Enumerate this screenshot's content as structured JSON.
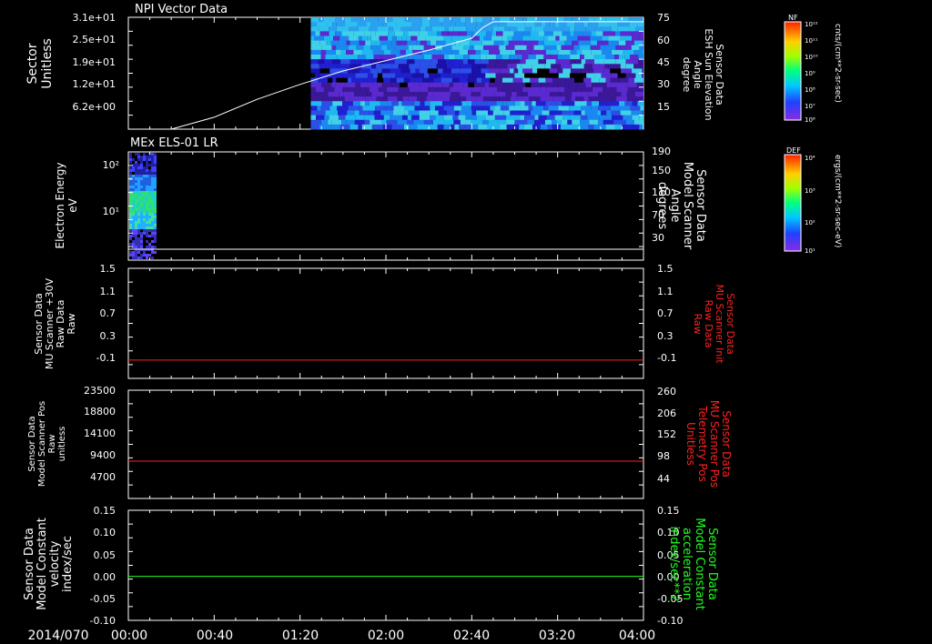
{
  "date_label": "2014/070",
  "time_ticks": [
    "00:00",
    "00:40",
    "01:20",
    "02:00",
    "02:40",
    "03:20",
    "04:00"
  ],
  "colors": {
    "red": "#ff2020",
    "green": "#20ff20",
    "white": "#ffffff"
  },
  "colorbars": [
    {
      "title": "NF",
      "units": "cnts/(cm**2-sr-sec)",
      "tick_labels": [
        "10¹²",
        "10¹¹",
        "10¹⁰",
        "10⁹",
        "10⁸",
        "10⁷",
        "10⁶"
      ]
    },
    {
      "title": "DEF",
      "units": "ergs/(cm**2-sr-sec-eV)",
      "tick_labels": [
        "10⁴",
        "10³",
        "10²",
        "10¹"
      ]
    }
  ],
  "chart_data": [
    {
      "type": "heatmap",
      "title": "NPI Vector Data",
      "ylabel": [
        "Sector",
        "Unitless"
      ],
      "yticks": [
        "3.1e+01",
        "2.5e+01",
        "1.9e+01",
        "1.2e+01",
        "6.2e+00"
      ],
      "ylabel_right": [
        "Sensor Data",
        "ESH Sun Elevation",
        "Angle",
        "degree"
      ],
      "yticks_right": [
        "75",
        "60",
        "45",
        "30",
        "15"
      ],
      "ylim_right": [
        0,
        75
      ],
      "data_start_time": "01:25",
      "overlay_line": {
        "name": "ESH Sun Elevation Angle",
        "x": [
          "00:00",
          "00:20",
          "00:40",
          "01:00",
          "01:20",
          "01:40",
          "02:00",
          "02:20",
          "02:40",
          "02:45",
          "02:50",
          "04:00"
        ],
        "y": [
          0,
          0,
          8,
          20,
          30,
          39,
          46,
          53,
          61,
          68,
          72,
          72
        ]
      }
    },
    {
      "type": "heatmap",
      "title": "MEx ELS-01 LR",
      "ylabel": [
        "Electron Energy",
        "eV"
      ],
      "yticks": [
        "10²",
        "10¹"
      ],
      "yscale": "log",
      "ylabel_right": [
        "Sensor Data",
        "Model Scanner",
        "Angle",
        "degrees"
      ],
      "yticks_right": [
        "190",
        "150",
        "110",
        "70",
        "30"
      ],
      "ylim_right": [
        0,
        190
      ],
      "data_end_time": "00:12",
      "overlay_line": {
        "name": "Model Scanner Angle",
        "x": [
          "00:00",
          "04:00"
        ],
        "y": [
          10,
          10
        ]
      }
    },
    {
      "type": "line",
      "ylabel": [
        "Sensor Data",
        "MU Scanner +30V",
        "Raw Data",
        "Raw"
      ],
      "yticks": [
        "1.5",
        "1.1",
        "0.7",
        "0.3",
        "-0.1"
      ],
      "ylim": [
        -0.3,
        1.5
      ],
      "ylabel_right": [
        "Sensor Data",
        "MU Scanner Init",
        "Raw Data",
        "Raw"
      ],
      "yticks_right": [
        "1.5",
        "1.1",
        "0.7",
        "0.3",
        "-0.1"
      ],
      "series": [
        {
          "x": [
            "00:00",
            "04:00"
          ],
          "y": [
            0.0,
            0.0
          ]
        }
      ]
    },
    {
      "type": "line",
      "ylabel": [
        "Sensor Data",
        "Model Scanner Pos",
        "Raw",
        "unitless"
      ],
      "yticks": [
        "23500",
        "18800",
        "14100",
        "9400",
        "4700"
      ],
      "ylim": [
        0,
        23500
      ],
      "ylabel_right": [
        "Sensor Data",
        "MU Scanner Pos",
        "Telemetry Pos",
        "Unitless"
      ],
      "yticks_right": [
        "260",
        "206",
        "152",
        "98",
        "44"
      ],
      "ylim_right": [
        0,
        260
      ],
      "series": [
        {
          "x": [
            "00:00",
            "04:00"
          ],
          "y": [
            8100,
            8100
          ]
        }
      ]
    },
    {
      "type": "line",
      "ylabel": [
        "Sensor Data",
        "Model Constant",
        "velocity",
        "index/sec"
      ],
      "yticks": [
        "0.15",
        "0.10",
        "0.05",
        "0.00",
        "-0.05",
        "-0.10"
      ],
      "ylim": [
        -0.1,
        0.15
      ],
      "ylabel_right": [
        "Sensor Data",
        "Model Constant",
        "acceleration",
        "index/sec**2"
      ],
      "yticks_right": [
        "0.15",
        "0.10",
        "0.05",
        "0.00",
        "-0.05",
        "-0.10"
      ],
      "series": [
        {
          "x": [
            "00:00",
            "04:00"
          ],
          "y": [
            0.0,
            0.0
          ]
        }
      ]
    }
  ]
}
